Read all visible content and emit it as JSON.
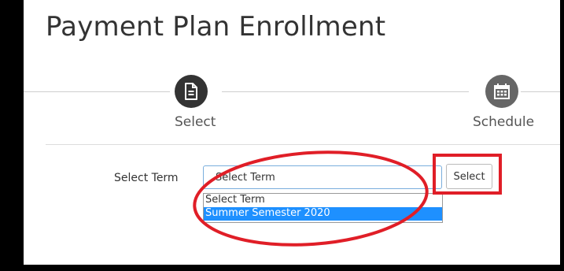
{
  "page": {
    "title": "Payment Plan Enrollment"
  },
  "steps": [
    {
      "label": "Select",
      "icon": "document-icon",
      "color": "#333333"
    },
    {
      "label": "Schedule",
      "icon": "calendar-icon",
      "color": "#666666"
    }
  ],
  "term_field": {
    "label": "Select Term",
    "selected_value": "Select Term",
    "options": [
      "Select Term",
      "Summer Semester 2020"
    ],
    "highlighted_option": "Summer Semester 2020"
  },
  "select_button": {
    "label": "Select"
  },
  "colors": {
    "annotation_red": "#e01e27",
    "highlight_blue": "#1e90ff",
    "focus_border": "#7aaedd"
  }
}
